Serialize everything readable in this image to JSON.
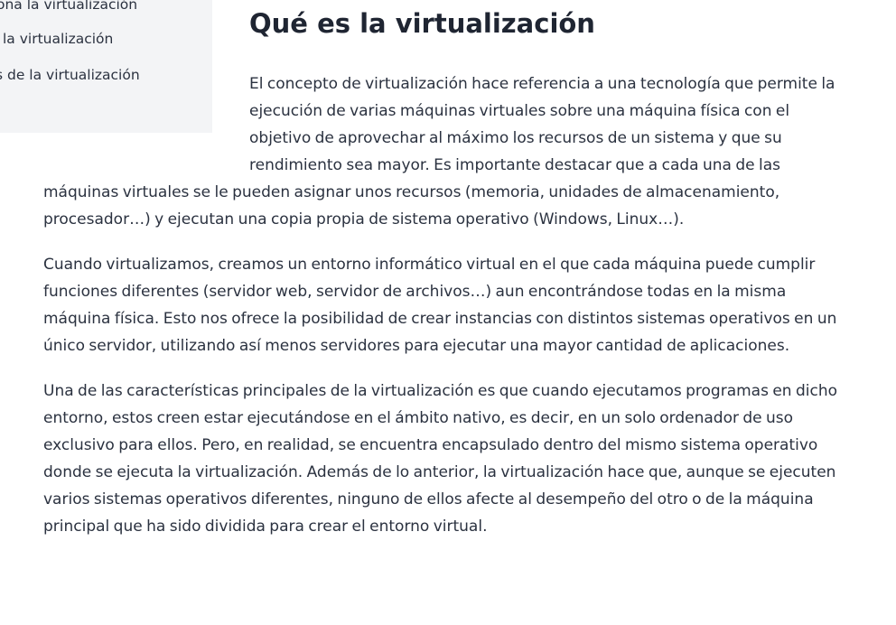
{
  "toc": {
    "items": [
      "ona la virtualización",
      "la virtualización",
      "s de la virtualización"
    ]
  },
  "article": {
    "title": "Qué es la virtualización",
    "paragraphs": [
      "El concepto de virtualización hace referencia a una tecnología que permite la ejecución de varias máquinas virtuales sobre una máquina física con el objetivo de aprovechar al máximo los recursos de un sistema y que su rendimiento sea mayor. Es importante destacar que a cada una de las máquinas virtuales se le pueden asignar unos recursos (memoria, unidades de almacenamiento, procesador…) y ejecutan una copia propia de sistema operativo (Windows, Linux…).",
      "Cuando virtualizamos, creamos un entorno informático virtual en el que cada máquina puede cumplir funciones diferentes (servidor web, servidor de archivos…) aun encontrándose todas en la misma máquina física. Esto nos ofrece la posibilidad de crear instancias con distintos sistemas operativos en un único servidor, utilizando así menos servidores para ejecutar una mayor cantidad de aplicaciones.",
      "Una de las características principales de la virtualización es que cuando ejecutamos programas en dicho entorno, estos creen estar ejecutándose en el ámbito nativo, es decir, en un solo ordenador de uso exclusivo para ellos. Pero, en realidad, se encuentra encapsulado dentro del mismo sistema operativo donde se ejecuta la virtualización. Además de lo anterior, la virtualización hace que, aunque se ejecuten varios sistemas operativos diferentes, ninguno de ellos afecte al desempeño del otro o de la máquina principal que ha sido dividida para crear el entorno virtual."
    ]
  }
}
